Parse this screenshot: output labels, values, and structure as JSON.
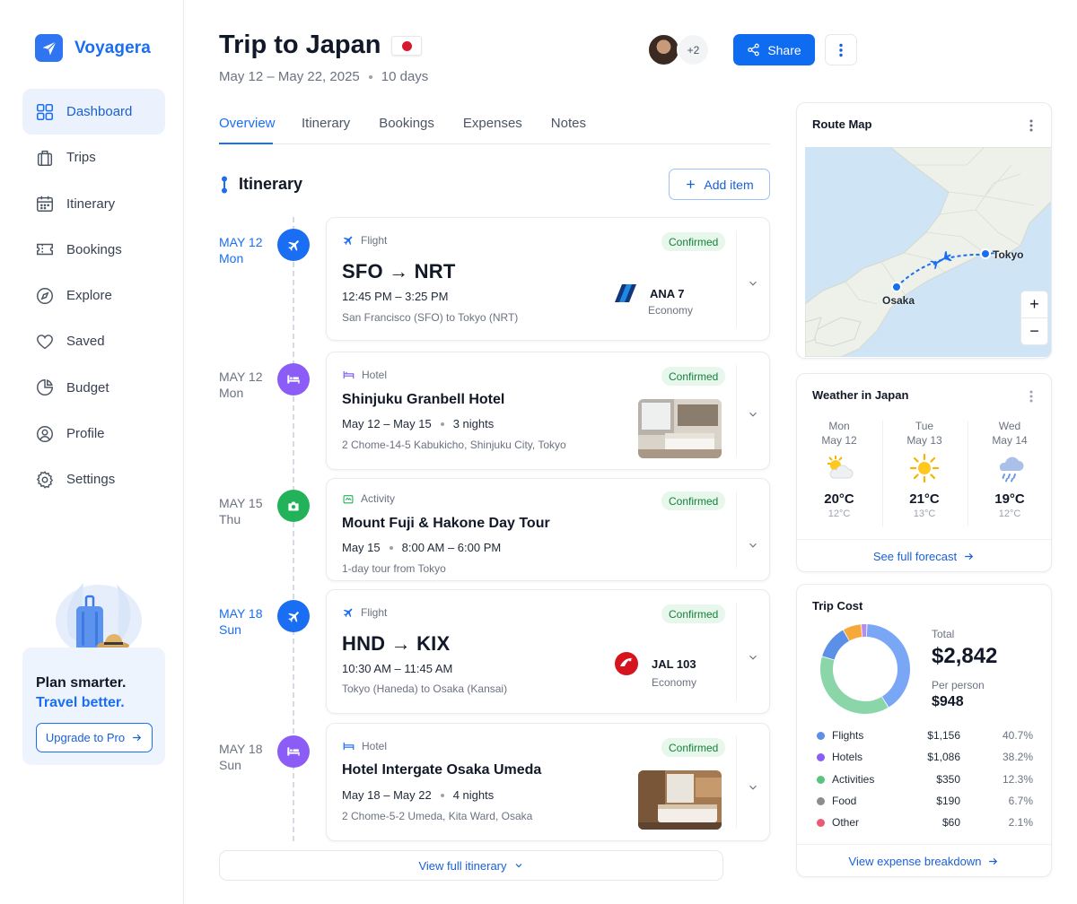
{
  "brand": {
    "name": "Voyagera",
    "icon": "paper-plane-icon"
  },
  "sidebar": {
    "items": [
      {
        "label": "Dashboard",
        "icon": "grid-icon",
        "active": true
      },
      {
        "label": "Trips",
        "icon": "suitcase-icon"
      },
      {
        "label": "Itinerary",
        "icon": "calendar-icon"
      },
      {
        "label": "Bookings",
        "icon": "ticket-icon"
      },
      {
        "label": "Explore",
        "icon": "compass-icon"
      },
      {
        "label": "Saved",
        "icon": "heart-icon"
      },
      {
        "label": "Budget",
        "icon": "pie-icon"
      },
      {
        "label": "Profile",
        "icon": "user-icon"
      },
      {
        "label": "Settings",
        "icon": "gear-icon"
      }
    ],
    "promo": {
      "line1": "Plan smarter.",
      "line2": "Travel better.",
      "button": "Upgrade to Pro"
    }
  },
  "header": {
    "title": "Trip to Japan",
    "dates": "May 12 – May 22, 2025",
    "duration": "10 days",
    "collaborators_more": "+2",
    "share_label": "Share"
  },
  "tabs": [
    "Overview",
    "Itinerary",
    "Bookings",
    "Expenses",
    "Notes"
  ],
  "itinerary": {
    "heading": "Itinerary",
    "add_label": "Add item",
    "view_full_label": "View full itinerary",
    "items": [
      {
        "date": "MAY 12",
        "day": "Mon",
        "type": "Flight",
        "status": "Confirmed",
        "title": "SFO → NRT",
        "time": "12:45 PM – 3:25 PM",
        "detail": "San Francisco (SFO) to Tokyo (NRT)",
        "airline": "ANA 7",
        "class": "Economy",
        "color": "#1a6ef3"
      },
      {
        "date": "MAY 12",
        "day": "Mon",
        "type": "Hotel",
        "status": "Confirmed",
        "title": "Shinjuku Granbell Hotel",
        "dates": "May 12 – May 15",
        "nights": "3 nights",
        "detail": "2 Chome-14-5 Kabukicho, Shinjuku City, Tokyo",
        "color": "#8b5cf6"
      },
      {
        "date": "MAY 15",
        "day": "Thu",
        "type": "Activity",
        "status": "Confirmed",
        "title": "Mount Fuji & Hakone Day Tour",
        "dates": "May 15",
        "time": "8:00 AM – 6:00 PM",
        "detail": "1-day tour from Tokyo",
        "color": "#22b35a"
      },
      {
        "date": "MAY 18",
        "day": "Sun",
        "type": "Flight",
        "status": "Confirmed",
        "title": "HND → KIX",
        "time": "10:30 AM – 11:45 AM",
        "detail": "Tokyo (Haneda) to Osaka (Kansai)",
        "airline": "JAL 103",
        "class": "Economy",
        "color": "#1a6ef3"
      },
      {
        "date": "MAY 18",
        "day": "Sun",
        "type": "Hotel",
        "status": "Confirmed",
        "title": "Hotel Intergate Osaka Umeda",
        "dates": "May 18 – May 22",
        "nights": "4 nights",
        "detail": "2 Chome-5-2 Umeda, Kita Ward, Osaka",
        "color": "#8b5cf6"
      }
    ]
  },
  "route_map": {
    "title": "Route Map",
    "from": "Osaka",
    "to": "Tokyo"
  },
  "weather": {
    "title": "Weather in Japan",
    "days": [
      {
        "day": "Mon",
        "date": "May 12",
        "icon": "partly-cloudy-icon",
        "high": "20°C",
        "low": "12°C"
      },
      {
        "day": "Tue",
        "date": "May 13",
        "icon": "sun-icon",
        "high": "21°C",
        "low": "13°C"
      },
      {
        "day": "Wed",
        "date": "May 14",
        "icon": "rain-icon",
        "high": "19°C",
        "low": "12°C"
      }
    ],
    "link": "See full forecast"
  },
  "trip_cost": {
    "title": "Trip Cost",
    "total_label": "Total",
    "total": "$2,842",
    "per_person_label": "Per person",
    "per_person": "$948",
    "link": "View expense breakdown",
    "rows": [
      {
        "name": "Flights",
        "amount": "$1,156",
        "pct": "40.7%",
        "value": 40.7,
        "color": "#7aa7f5"
      },
      {
        "name": "Hotels",
        "amount": "$1,086",
        "pct": "38.2%",
        "value": 38.2,
        "color": "#8ad6a8"
      },
      {
        "name": "Activities",
        "amount": "$350",
        "pct": "12.3%",
        "value": 12.3,
        "color": "#5b8fe8"
      },
      {
        "name": "Food",
        "amount": "$190",
        "pct": "6.7%",
        "value": 6.7,
        "color": "#f5a93a"
      },
      {
        "name": "Other",
        "amount": "$60",
        "pct": "2.1%",
        "value": 2.1,
        "color": "#b58cf0"
      }
    ]
  }
}
